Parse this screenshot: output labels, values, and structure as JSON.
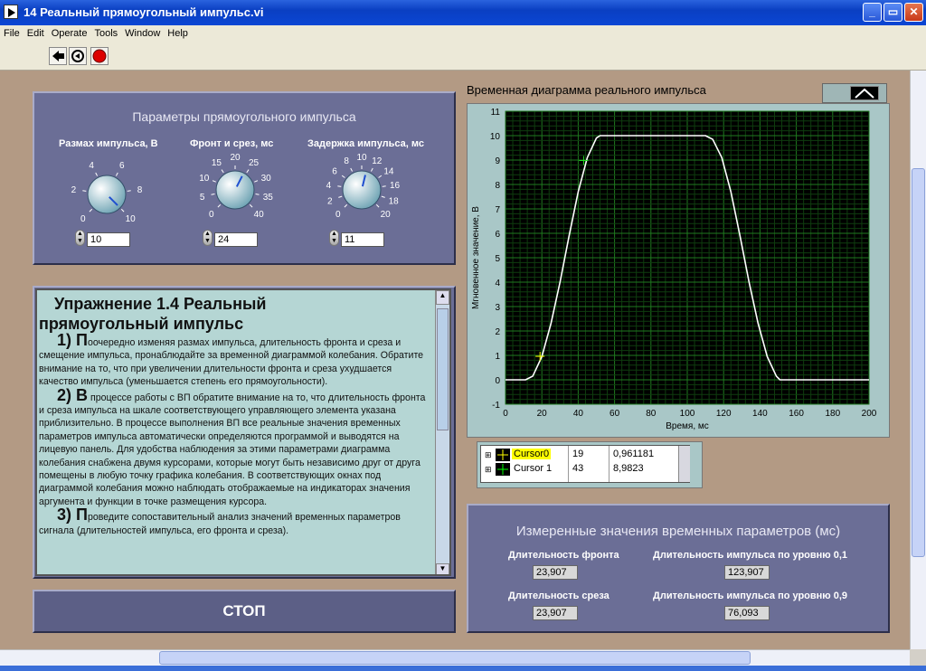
{
  "window": {
    "title": "14 Реальный прямоугольный импульс.vi",
    "minimize": "_",
    "restore": "▭",
    "close": "✕"
  },
  "menu": [
    "File",
    "Edit",
    "Operate",
    "Tools",
    "Window",
    "Help"
  ],
  "connector": {
    "num": "1"
  },
  "params": {
    "title": "Параметры прямоугольного импульса",
    "knobs": [
      {
        "label": "Размах импульса, В",
        "ticks": [
          "0",
          "2",
          "4",
          "6",
          "8",
          "10"
        ],
        "value": "10"
      },
      {
        "label": "Фронт и срез, мс",
        "ticks": [
          "0",
          "5",
          "10",
          "15",
          "20",
          "25",
          "30",
          "35",
          "40"
        ],
        "value": "24"
      },
      {
        "label": "Задержка импульса, мс",
        "ticks": [
          "0",
          "2",
          "4",
          "6",
          "8",
          "10",
          "12",
          "14",
          "16",
          "18",
          "20"
        ],
        "value": "11"
      }
    ]
  },
  "exercise": {
    "title1": "Упражнение 1.4 Реальный",
    "title2": "прямоугольный импульс",
    "p1_big": "1) П",
    "p1": "оочередно изменяя размах импульса, длительность фронта и среза и смещение импульса, пронаблюдайте за временной диаграммой колебания. Обратите внимание на то, что при увеличении длительности фронта и среза ухудшается качество импульса (уменьшается степень его прямоугольности).",
    "p2_big": "2) В",
    "p2": " процессе работы с ВП обратите внимание на то, что длительность фронта и среза импульса на шкале соответствующего управляющего элемента указана приблизительно. В процессе выполнения ВП все реальные значения временных параметров импульса автоматически определяются программой и выводятся на лицевую панель. Для удобства наблюдения за этими параметрами диаграмма колебания снабжена двумя курсорами, которые могут быть независимо друг от друга помещены в любую точку графика колебания. В соответствующих окнах под диаграммой колебания можно наблюдать отображаемые на индикаторах значения аргумента и функции в точке размещения курсора.",
    "p3_big": "3) П",
    "p3": "роведите сопоставительный анализ значений временных параметров сигнала (длительностей импульса, его фронта и среза)."
  },
  "stop_label": "СТОП",
  "chart_data": {
    "type": "line",
    "title": "Временная диаграмма реального импульса",
    "xlabel": "Время, мс",
    "ylabel": "Мгновенное значение, В",
    "xlim": [
      0,
      200
    ],
    "ylim": [
      -1,
      11
    ],
    "xticks": [
      "0",
      "20",
      "40",
      "60",
      "80",
      "100",
      "120",
      "140",
      "160",
      "180",
      "200"
    ],
    "yticks": [
      "-1",
      "0",
      "1",
      "2",
      "3",
      "4",
      "5",
      "6",
      "7",
      "8",
      "9",
      "10",
      "11"
    ],
    "grid": true,
    "series": [
      {
        "x": [
          0,
          11,
          15,
          20,
          25,
          30,
          35,
          40,
          45,
          50,
          52,
          55,
          85,
          100,
          110,
          114,
          119,
          124,
          129,
          134,
          139,
          144,
          149,
          151,
          200
        ],
        "y": [
          0,
          0,
          0.15,
          0.95,
          2.3,
          4,
          5.9,
          7.7,
          9.1,
          9.9,
          10,
          10,
          10,
          10,
          10,
          9.85,
          9.1,
          7.7,
          5.9,
          4,
          2.3,
          0.95,
          0.15,
          0,
          0
        ]
      }
    ],
    "cursors": [
      {
        "name": "Cursor0",
        "x": "19",
        "y": "0,961181"
      },
      {
        "name": "Cursor 1",
        "x": "43",
        "y": "8,9823"
      }
    ]
  },
  "measured": {
    "title": "Измеренные значения временных параметров (мс)",
    "front_label": "Длительность фронта",
    "front": "23,907",
    "fall_label": "Длительность среза",
    "fall": "23,907",
    "w01_label": "Длительность импульса по уровню 0,1",
    "w01": "123,907",
    "w09_label": "Длительность импульса по уровню 0,9",
    "w09": "76,093"
  }
}
